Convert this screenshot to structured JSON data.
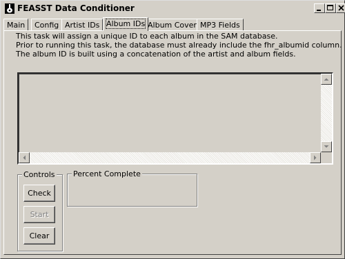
{
  "window": {
    "title": "FEASST Data Conditioner",
    "icon": "guitar-icon"
  },
  "tabs": [
    {
      "label": "Main"
    },
    {
      "label": "Config"
    },
    {
      "label": "Artist IDs"
    },
    {
      "label": "Album IDs",
      "active": true
    },
    {
      "label": "Album Covers"
    },
    {
      "label": "MP3 Fields"
    }
  ],
  "description": [
    "This task will assign a unique ID to each album in the SAM database.",
    "Prior to running this task, the database must already include the fhr_albumid column.",
    "The album ID is built using a concatenation of the artist and album fields."
  ],
  "controls": {
    "label": "Controls",
    "check_label": "Check",
    "start_label": "Start",
    "clear_label": "Clear"
  },
  "progress": {
    "label": "Percent Complete"
  }
}
